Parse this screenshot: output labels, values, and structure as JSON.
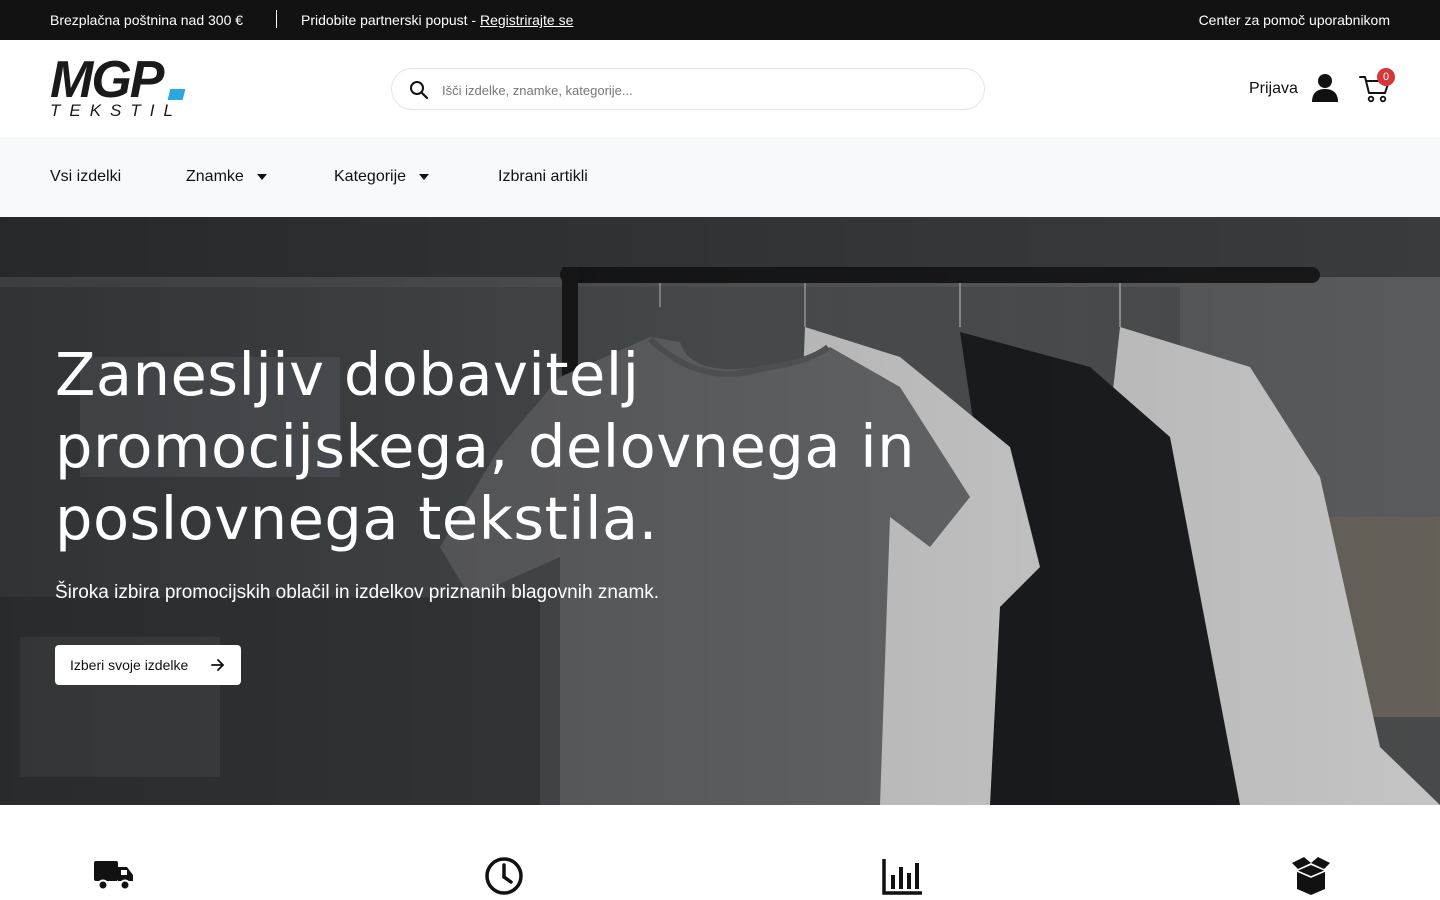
{
  "topbar": {
    "shipping": "Brezplačna poštnina nad 300 €",
    "partner_text": "Pridobite partnerski popust - ",
    "partner_link": "Registrirajte se",
    "help": "Center za pomoč uporabnikom"
  },
  "header": {
    "logo_main": "MGP",
    "logo_sub": "TEKSTIL",
    "search_placeholder": "Išči izdelke, znamke, kategorije...",
    "login": "Prijava",
    "cart_count": "0"
  },
  "nav": {
    "items": [
      {
        "label": "Vsi izdelki",
        "dropdown": false
      },
      {
        "label": "Znamke",
        "dropdown": true
      },
      {
        "label": "Kategorije",
        "dropdown": true
      },
      {
        "label": "Izbrani artikli",
        "dropdown": false
      }
    ]
  },
  "hero": {
    "line1": "Zanesljiv dobavitelj",
    "line2": "promocijskega, delovnega in",
    "line3": "poslovnega tekstila.",
    "subtitle": "Široka izbira promocijskih oblačil in izdelkov priznanih blagovnih znamk.",
    "cta": "Izberi svoje izdelke"
  },
  "features": {
    "icons": [
      "truck-icon",
      "clock-icon",
      "chart-icon",
      "box-icon"
    ]
  },
  "colors": {
    "topbar_bg": "#121212",
    "nav_bg": "#f8f9fb",
    "logo_accent": "#2aa9e0",
    "badge": "#d63638"
  }
}
